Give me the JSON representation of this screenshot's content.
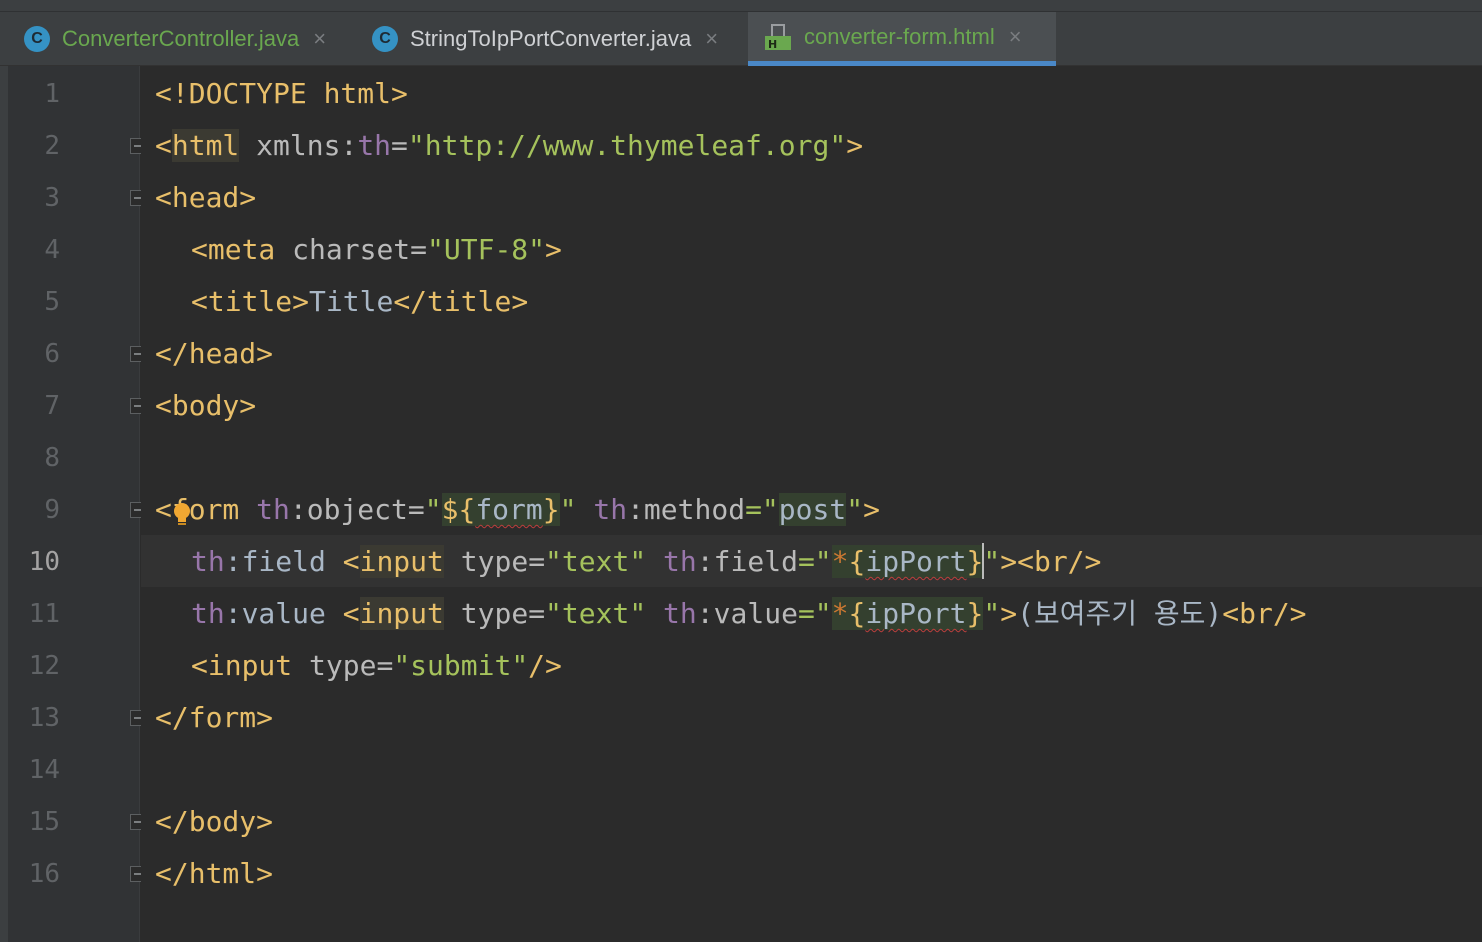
{
  "tabs": [
    {
      "label": "ConverterController.java",
      "icon": "class-icon",
      "active": false,
      "color": "#6aa84f"
    },
    {
      "label": "StringToIpPortConverter.java",
      "icon": "class-icon",
      "active": false,
      "color": "#cfd1d4"
    },
    {
      "label": "converter-form.html",
      "icon": "html-file-icon",
      "active": true,
      "color": "#6aa84f"
    }
  ],
  "tab_icon_letter": "C",
  "close_glyph": "×",
  "current_line": 10,
  "line_numbers": [
    "1",
    "2",
    "3",
    "4",
    "5",
    "6",
    "7",
    "8",
    "9",
    "10",
    "11",
    "12",
    "13",
    "14",
    "15",
    "16"
  ],
  "code": {
    "l1": {
      "doctype": "<!DOCTYPE html>"
    },
    "l2": {
      "open": "<",
      "tag": "html",
      "attr": " xmlns:",
      "ns": "th",
      "eq": "=",
      "val": "\"http://www.thymeleaf.org\"",
      "close": ">"
    },
    "l3": {
      "text": "<head>"
    },
    "l4": {
      "open": "<meta",
      "attr": " charset",
      "eq": "=",
      "val": "\"UTF-8\"",
      "close": ">"
    },
    "l5": {
      "open": "<title>",
      "text": "Title",
      "close": "</title>"
    },
    "l6": {
      "text": "</head>"
    },
    "l7": {
      "text": "<body>"
    },
    "l9": {
      "open": "<form",
      "ns1": " th",
      "attr1": ":object",
      "eq1": "=",
      "q1": "\"",
      "expr_start": "${",
      "expr_var": "form",
      "expr_end": "}",
      "q2": "\"",
      "ns2": " th",
      "attr2": ":method",
      "eq2": "=\"",
      "method_val": "post",
      "q3": "\"",
      "close": ">"
    },
    "l10": {
      "prefix_ns": "th",
      "prefix_text": ":field ",
      "open": "<",
      "tag": "input",
      "attr1": " type",
      "eq1": "=",
      "val1": "\"text\"",
      "ns2": " th",
      "attr2": ":field",
      "eq2": "=\"",
      "star": "*",
      "brace_open": "{",
      "var": "ipPort",
      "brace_close": "}",
      "q_end": "\"",
      "close": "><br/>"
    },
    "l11": {
      "prefix_ns": "th",
      "prefix_text": ":value ",
      "open": "<",
      "tag": "input",
      "attr1": " type",
      "eq1": "=",
      "val1": "\"text\"",
      "ns2": " th",
      "attr2": ":value",
      "eq2": "=\"",
      "star": "*",
      "brace_open": "{",
      "var": "ipPort",
      "brace_close": "}",
      "q_end": "\"",
      "close": ">",
      "text": "(보여주기 용도)",
      "br": "<br/>"
    },
    "l12": {
      "open": "<input",
      "attr": " type",
      "eq": "=",
      "val": "\"submit\"",
      "close": "/>"
    },
    "l13": {
      "text": "</form>"
    },
    "l15": {
      "text": "</body>"
    },
    "l16": {
      "text": "</html>"
    }
  }
}
